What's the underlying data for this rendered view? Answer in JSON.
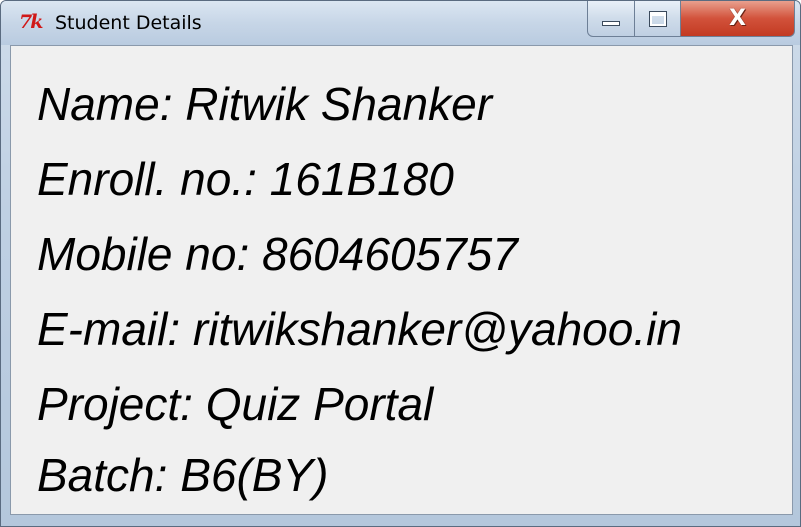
{
  "window": {
    "title": "Student Details",
    "icon": "tk-feather-icon",
    "icon_text": "7k",
    "controls": {
      "minimize_icon": "minimize-icon",
      "maximize_icon": "maximize-icon",
      "close_icon": "close-icon",
      "close_glyph": "X"
    }
  },
  "details": [
    {
      "text": "Name: Ritwik Shanker"
    },
    {
      "text": "Enroll. no.: 161B180"
    },
    {
      "text": "Mobile no: 8604605757"
    },
    {
      "text": "E-mail: ritwikshanker@yahoo.in"
    },
    {
      "text": "Project: Quiz Portal"
    },
    {
      "text": "Batch: B6(BY)"
    }
  ],
  "colors": {
    "icon_red": "#d01818",
    "close_red": "#c23a22",
    "client_bg": "#f0f0f0"
  }
}
